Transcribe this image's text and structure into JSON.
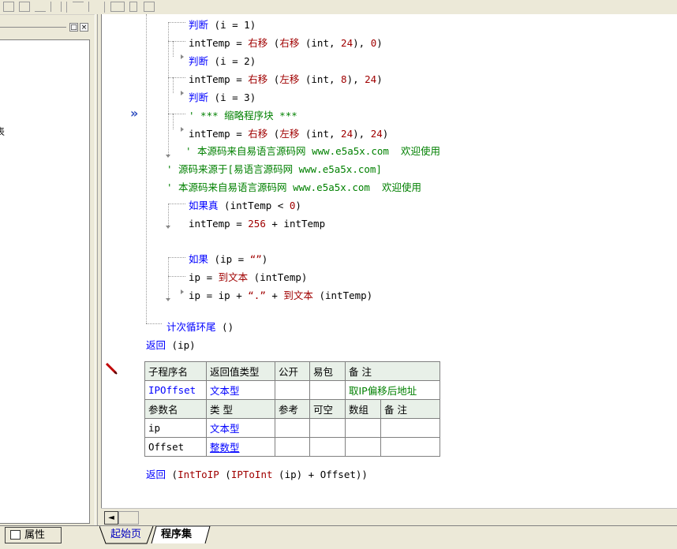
{
  "left_panel": {
    "restore_glyph": "□",
    "close_glyph": "×",
    "clipped_char": "表"
  },
  "margin": {
    "current_line_marker": "»",
    "breakpoint_marker": "pencil-icon"
  },
  "code": {
    "l1": {
      "kw": "判断",
      "rest": " (i = 1)"
    },
    "l2": {
      "a": "intTemp = ",
      "f1": "右移",
      "b": " (",
      "f2": "右移",
      "c": " (int, ",
      "n1": "24",
      "d": "), ",
      "n2": "0",
      "e": ")"
    },
    "l3": {
      "kw": "判断",
      "rest": " (i = 2)"
    },
    "l4": {
      "a": "intTemp = ",
      "f1": "右移",
      "b": " (",
      "f2": "左移",
      "c": " (int, ",
      "n1": "8",
      "d": "), ",
      "n2": "24",
      "e": ")"
    },
    "l5": {
      "kw": "判断",
      "rest": " (i = 3)"
    },
    "l6": {
      "text": "' *** 缩略程序块 ***"
    },
    "l7": {
      "a": "intTemp = ",
      "f1": "右移",
      "b": " (",
      "f2": "左移",
      "c": " (int, ",
      "n1": "24",
      "d": "), ",
      "n2": "24",
      "e": ")"
    },
    "l8": {
      "text": "' 本源码来自易语言源码网 www.e5a5x.com  欢迎使用"
    },
    "l9": {
      "text": "' 源码来源于[易语言源码网 www.e5a5x.com]"
    },
    "l10": {
      "text": "' 本源码来自易语言源码网 www.e5a5x.com  欢迎使用"
    },
    "l11": {
      "kw": "如果真",
      "rest": " (intTemp < ",
      "n": "0",
      "e": ")"
    },
    "l12": {
      "a": "intTemp = ",
      "n": "256",
      "b": " + intTemp"
    },
    "l13": {
      "kw": "如果",
      "rest": " (ip = ",
      "s": "“”",
      "e": ")"
    },
    "l14": {
      "a": "ip = ",
      "f": "到文本",
      "b": " (intTemp)"
    },
    "l15": {
      "a": "ip = ip + ",
      "s": "“.”",
      "b": " + ",
      "f": "到文本",
      "c": " (intTemp)"
    },
    "l16": {
      "kw": "计次循环尾",
      "rest": " ()"
    },
    "l17": {
      "kw": "返回",
      "rest": " (ip)"
    },
    "l18": {
      "kw": "返回",
      "rest": " (",
      "f": "IntToIP",
      "b": " (",
      "f2": "IPToInt",
      "c": " (ip) + Offset))"
    }
  },
  "sub_table": {
    "header": [
      "子程序名",
      "返回值类型",
      "公开",
      "易包",
      "备 注"
    ],
    "row": [
      "IPOffset",
      "文本型",
      "",
      "",
      "取IP偏移后地址"
    ],
    "param_header": [
      "参数名",
      "类 型",
      "参考",
      "可空",
      "数组",
      "备 注"
    ],
    "params": [
      [
        "ip",
        "文本型",
        "",
        "",
        "",
        ""
      ],
      [
        "Offset",
        "整数型",
        "",
        "",
        "",
        ""
      ]
    ]
  },
  "scrollbar": {
    "left_arrow": "◄"
  },
  "bottom": {
    "properties_label": "属性",
    "tabs": [
      "起始页",
      "程序集"
    ]
  }
}
